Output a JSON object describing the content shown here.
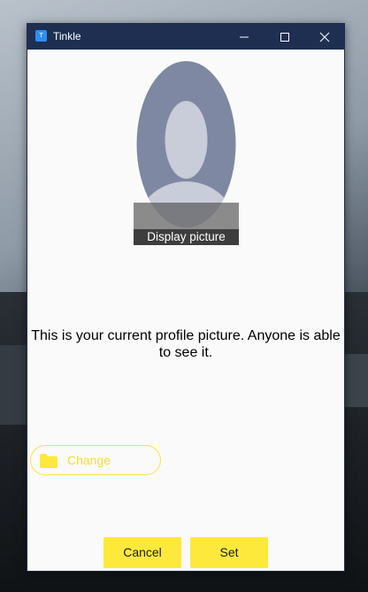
{
  "window": {
    "title": "Tinkle",
    "app_icon_glyph": "T",
    "controls": {
      "minimize_icon": "minimize-icon",
      "maximize_icon": "maximize-icon",
      "close_icon": "close-icon"
    }
  },
  "profile": {
    "avatar_icon": "default-avatar-icon",
    "caption": "Display picture",
    "info": "This is your current profile picture. Anyone is able to see it."
  },
  "actions": {
    "change_label": "Change",
    "change_icon": "folder-icon",
    "cancel_label": "Cancel",
    "set_label": "Set"
  },
  "colors": {
    "titlebar": "#1e2f52",
    "accent": "#fde93c",
    "change_text": "#f4de33",
    "avatar_body": "#7e88a2",
    "avatar_face": "#c9ccd9"
  }
}
